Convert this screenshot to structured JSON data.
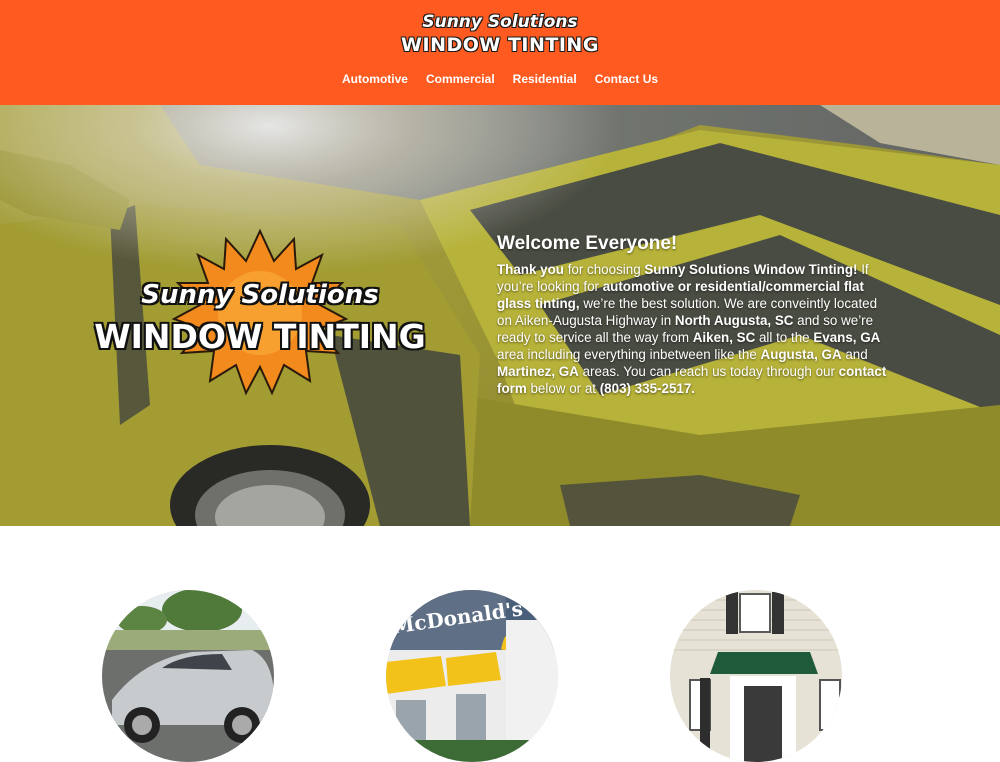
{
  "header": {
    "logo_line1": "Sunny Solutions",
    "logo_line2": "WINDOW TINTING",
    "background_color": "#ff5a1f"
  },
  "nav": {
    "items": [
      {
        "label": "Automotive"
      },
      {
        "label": "Commercial"
      },
      {
        "label": "Residential"
      },
      {
        "label": "Contact Us"
      }
    ]
  },
  "hero": {
    "logo_line1": "Sunny Solutions",
    "logo_line2": "WINDOW TINTING",
    "logo_icon": "sun-icon",
    "heading": "Welcome Everyone!",
    "paragraph": {
      "s1": "Thank you",
      "s2": " for choosing ",
      "s3": "Sunny Solutions Window Tinting!",
      "s4": " If you’re looking for ",
      "s5": "automotive or residential/commercial flat glass tinting,",
      "s6": " we’re the best solution.  We are conveintly located on Aiken-Augusta Highway in ",
      "s7": "North Augusta, SC",
      "s8": " and so we’re ready to service all the way from ",
      "s9": "Aiken, SC",
      "s10": " all to the ",
      "s11": "Evans, GA",
      "s12": " area including everything inbetween like the ",
      "s13": "Augusta, GA",
      "s14": " and ",
      "s15": "Martinez, GA",
      "s16": " areas. You can reach us today through our ",
      "s17": "contact form",
      "s18": " below or at ",
      "s19": "(803) 335-2517",
      "s20": "."
    }
  },
  "features": [
    {
      "image": "silver-car-photo"
    },
    {
      "image": "mcdonalds-building-photo",
      "sign_text": "McDonald's"
    },
    {
      "image": "house-entrance-photo"
    }
  ]
}
